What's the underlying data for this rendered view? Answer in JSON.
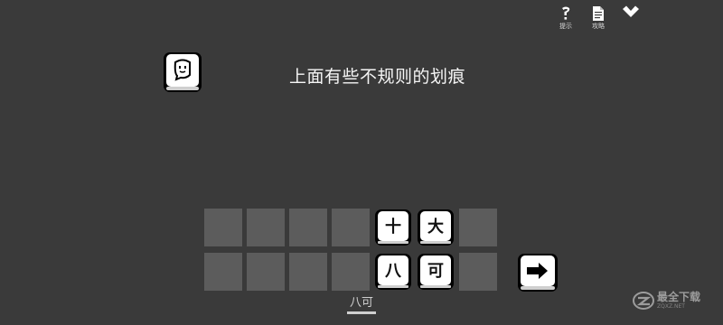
{
  "toolbar": {
    "hint_label": "提示",
    "strategy_label": "攻略"
  },
  "puzzle": {
    "text": "上面有些不规则的划痕"
  },
  "board": {
    "rows": [
      [
        "",
        "",
        "",
        "",
        "十",
        "大",
        ""
      ],
      [
        "",
        "",
        "",
        "",
        "八",
        "可",
        ""
      ]
    ]
  },
  "answer": {
    "text": "八可"
  },
  "watermark": {
    "text": "最全下载",
    "sub": "ZQXZ.NET"
  },
  "colors": {
    "background": "#3a3a3a",
    "empty_slot": "#5c5c5c",
    "key_face": "#ffffff",
    "key_border": "#000000"
  }
}
